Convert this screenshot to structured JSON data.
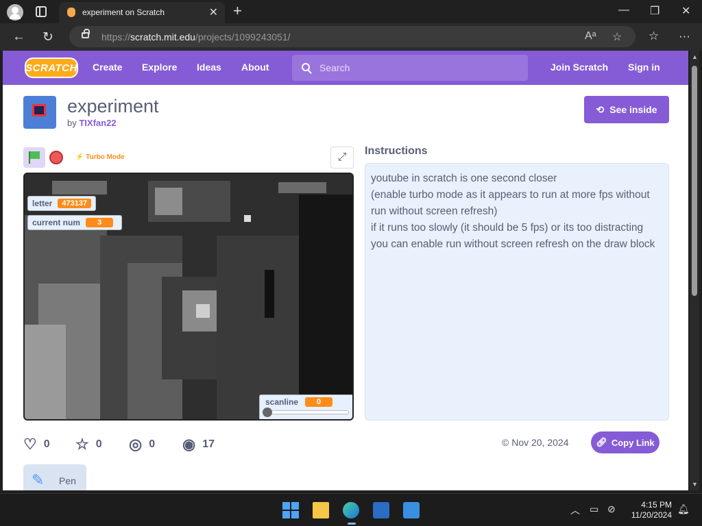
{
  "browser": {
    "tab_title": "experiment on Scratch",
    "url_prefix": "https://",
    "url_host": "scratch.mit.edu",
    "url_path": "/projects/1099243051/"
  },
  "nav": {
    "logo": "SCRATCH",
    "links": [
      "Create",
      "Explore",
      "Ideas",
      "About"
    ],
    "search_placeholder": "Search",
    "join": "Join Scratch",
    "signin": "Sign in"
  },
  "project": {
    "title": "experiment",
    "by": "by",
    "author": "TIXfan22",
    "see_inside": "See inside",
    "turbo": "Turbo Mode"
  },
  "stage": {
    "monitors": [
      {
        "label": "letter",
        "value": "473137"
      },
      {
        "label": "current num",
        "value": "3"
      }
    ],
    "slider": {
      "label": "scanline",
      "value": "0"
    }
  },
  "instructions": {
    "title": "Instructions",
    "lines": [
      "youtube in scratch is one second closer",
      "(enable turbo mode as it appears to run at more fps without run without screen refresh)",
      "if it runs too slowly (it should be 5 fps) or its too distracting you can enable run without screen refresh on the draw block"
    ]
  },
  "stats": {
    "loves": "0",
    "favorites": "0",
    "remixes": "0",
    "views": "17",
    "date": "Nov 20, 2024",
    "copy_link": "Copy Link"
  },
  "tags": {
    "pen": "Pen"
  },
  "taskbar": {
    "time": "4:15 PM",
    "date": "11/20/2024"
  },
  "colors": {
    "scratch_purple": "#855cd6",
    "monitor_orange": "#ff8c1a"
  }
}
